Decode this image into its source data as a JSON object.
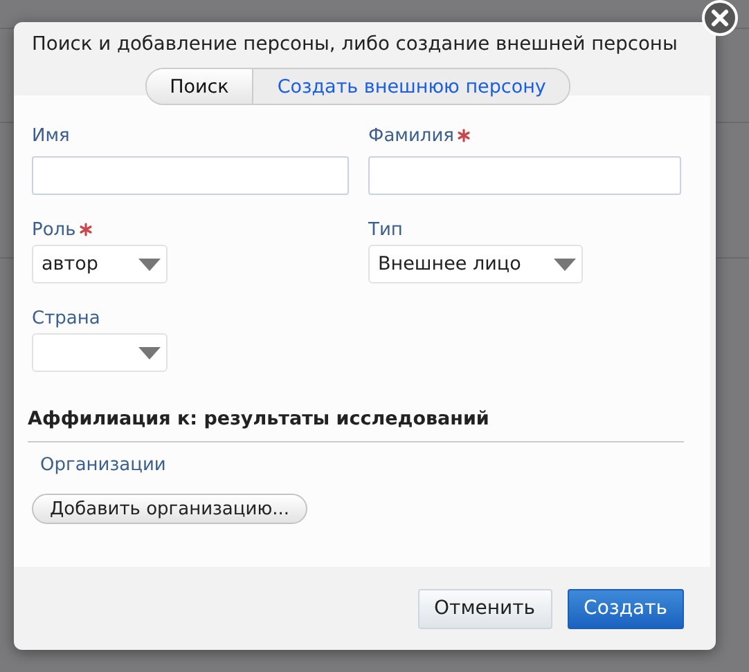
{
  "dialog": {
    "title": "Поиск и добавление персоны, либо создание внешней персоны",
    "tabs": [
      {
        "label": "Поиск",
        "selected": false
      },
      {
        "label": "Создать внешнюю персону",
        "selected": true
      }
    ],
    "fields": [
      {
        "kind": "text",
        "label": "Имя",
        "required": false
      },
      {
        "kind": "text",
        "label": "Фамилия",
        "required": true
      },
      {
        "kind": "select",
        "label": "Роль",
        "required": true,
        "value": "автор"
      },
      {
        "kind": "select",
        "label": "Тип",
        "required": false,
        "value": "Внешнее лицо"
      },
      {
        "kind": "select",
        "label": "Страна",
        "required": false
      }
    ],
    "section": {
      "heading": "Аффилиация к: результаты исследований",
      "link": "Организации",
      "button": "Добавить организацию..."
    },
    "buttons": [
      {
        "label": "Отменить",
        "primary": false
      },
      {
        "label": "Создать",
        "primary": true
      }
    ]
  }
}
